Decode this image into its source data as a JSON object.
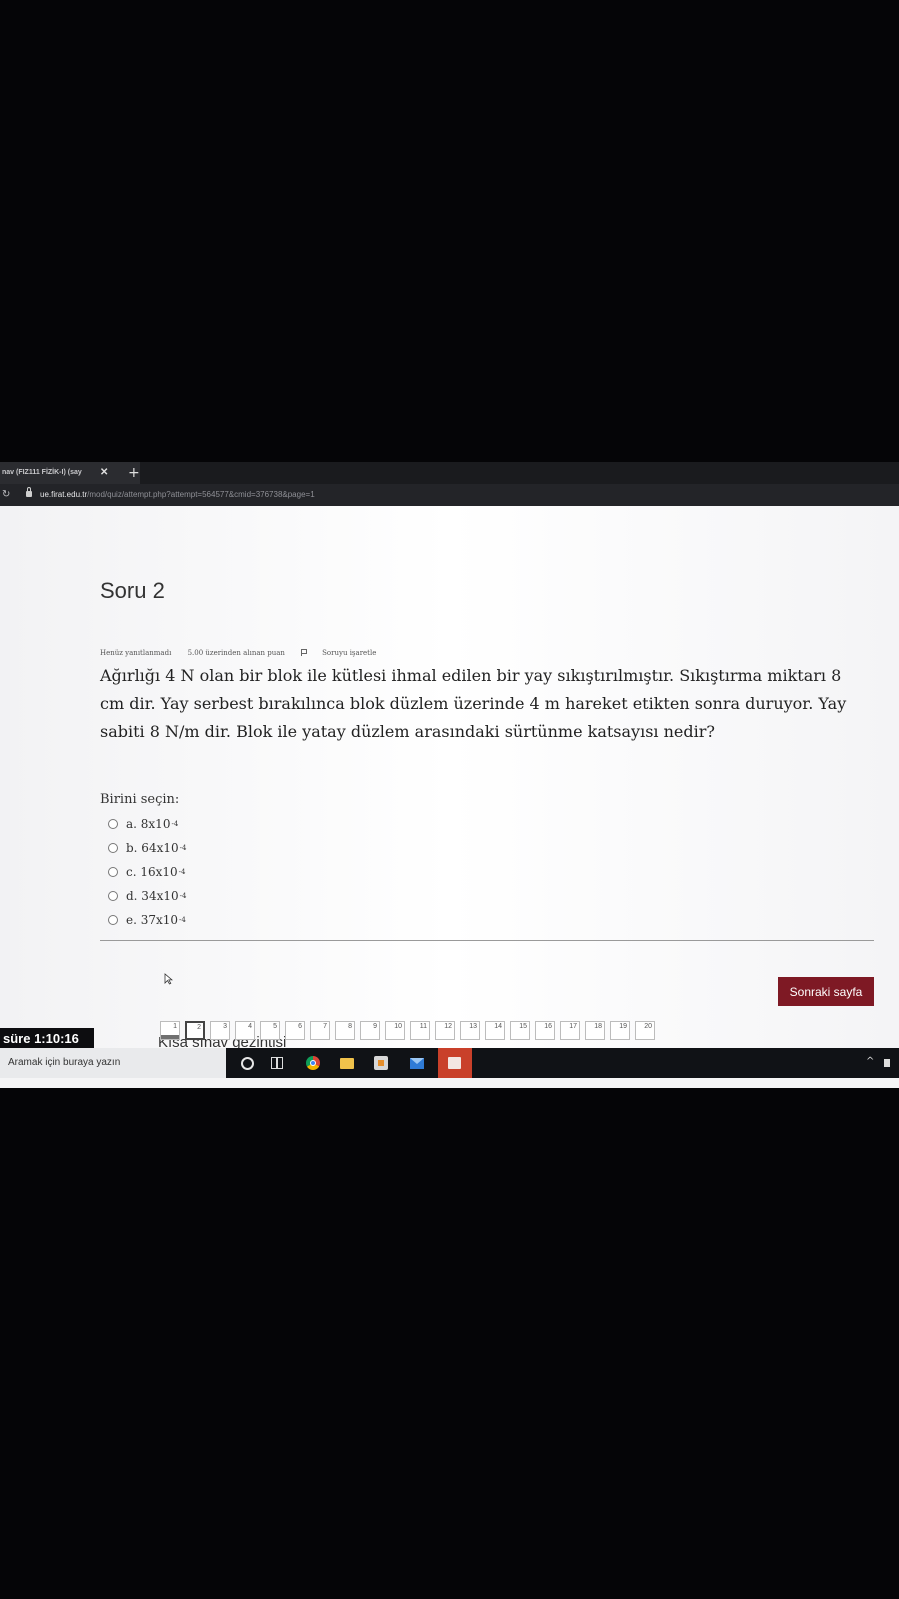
{
  "browser": {
    "tab_title": "nav (FIZ111 FİZİK-I) (say",
    "close_glyph": "✕",
    "new_tab_glyph": "+",
    "reload_glyph": "↻",
    "url_host": "ue.firat.edu.tr",
    "url_path": "/mod/quiz/attempt.php?attempt=564577&cmid=376738&page=1"
  },
  "question": {
    "title": "Soru 2",
    "status": "Henüz yanıtlanmadı",
    "points": "5.00 üzerinden alınan puan",
    "flag_label": "Soruyu işaretle",
    "text": "Ağırlığı 4 N olan bir blok ile kütlesi ihmal edilen bir yay sıkıştırılmıştır. Sıkıştırma miktarı 8 cm dir. Yay serbest bırakılınca blok düzlem üzerinde 4 m hareket etikten sonra duruyor. Yay sabiti 8 N/m dir. Blok ile yatay düzlem arasındaki sürtünme katsayısı nedir?",
    "prompt": "Birini seçin:",
    "answers": [
      {
        "label": "a. 8x10",
        "exp": "-4"
      },
      {
        "label": "b. 64x10",
        "exp": "-4"
      },
      {
        "label": "c. 16x10",
        "exp": "-4"
      },
      {
        "label": "d. 34x10",
        "exp": "-4"
      },
      {
        "label": "e. 37x10",
        "exp": "-4"
      }
    ]
  },
  "next_button": "Sonraki sayfa",
  "quiz_nav": {
    "title": "Kısa sınav gezintisi",
    "timer": "süre 1:10:16",
    "pages": [
      "1",
      "2",
      "3",
      "4",
      "5",
      "6",
      "7",
      "8",
      "9",
      "10",
      "11",
      "12",
      "13",
      "14",
      "15",
      "16",
      "17",
      "18",
      "19",
      "20"
    ],
    "current": "2",
    "visited": "1"
  },
  "taskbar": {
    "search_placeholder": "Aramak için buraya yazın"
  }
}
